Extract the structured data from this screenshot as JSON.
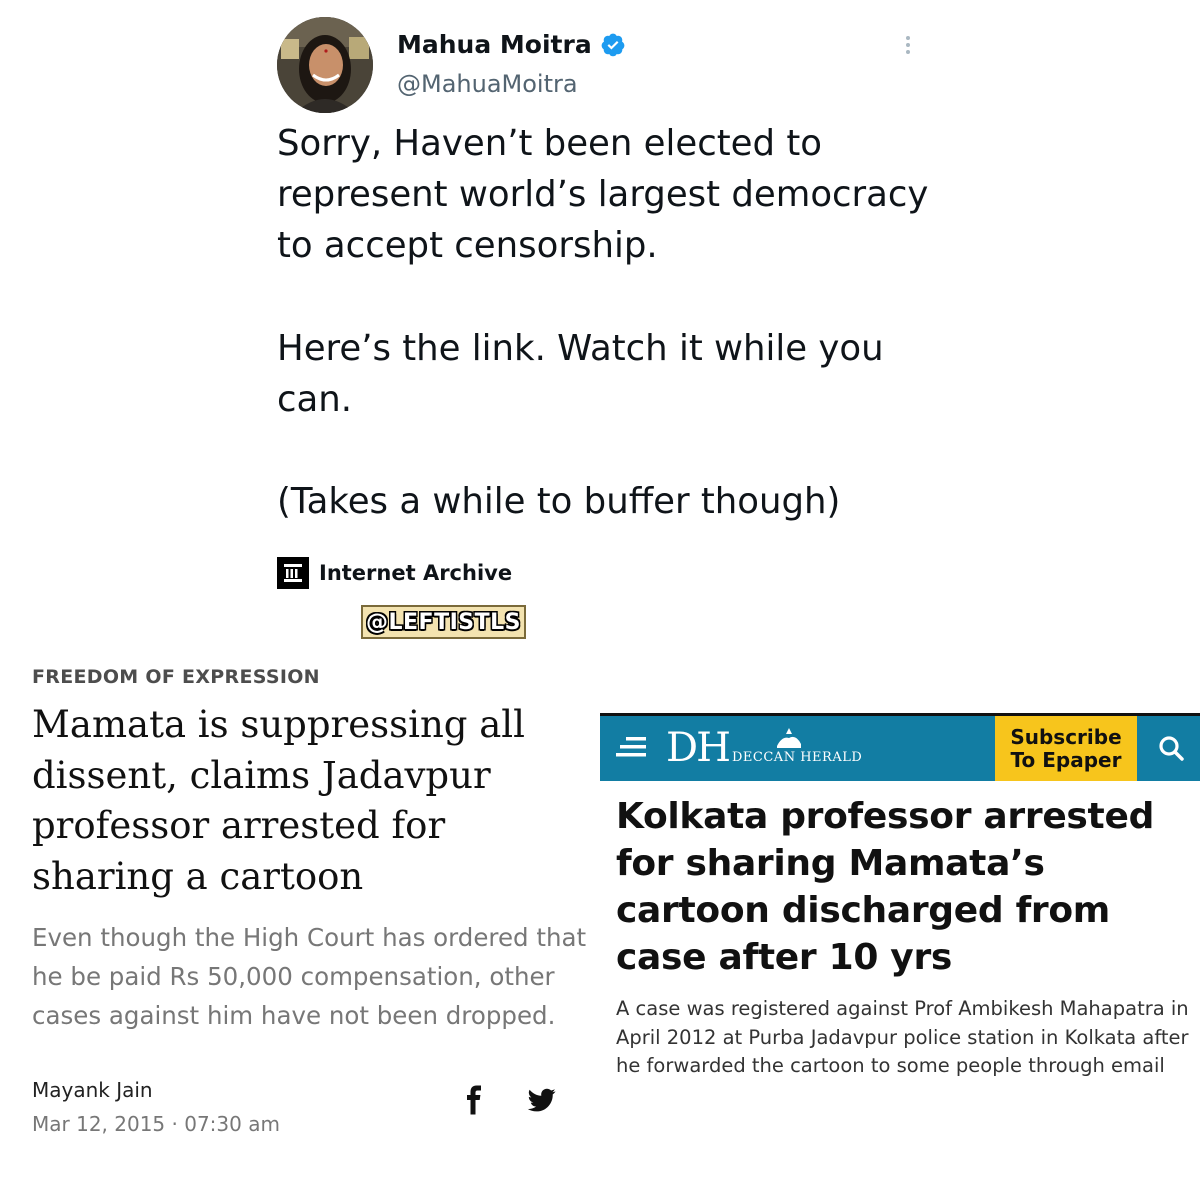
{
  "tweet": {
    "display_name": "Mahua Moitra",
    "handle": "@MahuaMoitra",
    "verified_icon": "verified-badge-icon",
    "more_icon": "more-options-icon",
    "paragraphs": [
      "Sorry, Haven’t been elected to represent world’s largest democracy to accept censorship.",
      "Here’s the link. Watch it while you can.",
      "(Takes a while to buffer though)"
    ],
    "link_card": {
      "icon": "internet-archive-icon",
      "label": "Internet Archive"
    }
  },
  "watermark": "@LEFTISTLS",
  "scroll_article": {
    "kicker": "FREEDOM OF EXPRESSION",
    "title": "Mamata is suppressing all dissent, claims Jadavpur professor arrested for sharing a cartoon",
    "subtitle": "Even though the High Court has ordered that he be paid Rs 50,000 compensation, other cases against him have not been dropped.",
    "author": "Mayank Jain",
    "date": "Mar 12, 2015 · 07:30 am",
    "share_icons": [
      "facebook-icon",
      "twitter-icon"
    ]
  },
  "deccan_herald": {
    "logo": "DH",
    "logo_subtitle": "DECCAN HERALD",
    "subscribe_line1": "Subscribe",
    "subscribe_line2": "To Epaper",
    "brand_color": "#127da3",
    "subscribe_color": "#f7c51c",
    "headline": "Kolkata professor arrested for sharing Mamata’s cartoon discharged from case after 10 yrs",
    "summary": "A case was registered against Prof Ambikesh Mahapatra in April 2012 at Purba Jadavpur police station in Kolkata after he forwarded the cartoon to some people through email"
  }
}
